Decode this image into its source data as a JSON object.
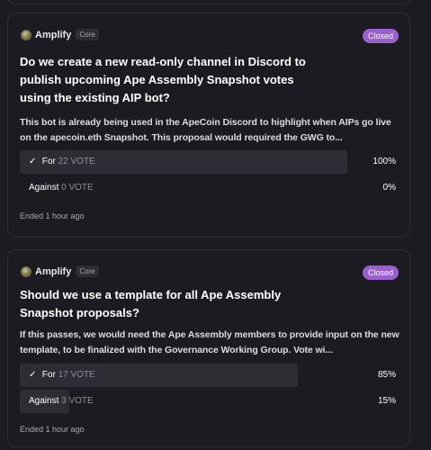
{
  "proposals": [
    {
      "space": "Amplify",
      "tag": "Core",
      "state": "Closed",
      "title": "Do we create a new read-only channel in Discord to publish upcoming Ape Assembly Snapshot votes using the existing AIP bot?",
      "body": "This bot is already being used in the ApeCoin Discord to highlight when AIPs go live on the apecoin.eth Snapshot. This proposal would required the GWG to...",
      "choices": [
        {
          "label": "For",
          "votes": "22 VOTE",
          "percent": "100%",
          "share": 1.0,
          "winner": true
        },
        {
          "label": "Against",
          "votes": "0 VOTE",
          "percent": "0%",
          "share": 0.0,
          "winner": false
        }
      ],
      "ended": "Ended 1 hour ago"
    },
    {
      "space": "Amplify",
      "tag": "Core",
      "state": "Closed",
      "title": "Should we use a template for all Ape Assembly Snapshot proposals?",
      "body": "If this passes, we would need the Ape Assembly members to provide input on the new template, to be finalized with the Governance Working Group. Vote wi...",
      "choices": [
        {
          "label": "For",
          "votes": "17 VOTE",
          "percent": "85%",
          "share": 0.85,
          "winner": true
        },
        {
          "label": "Against",
          "votes": "3 VOTE",
          "percent": "15%",
          "share": 0.15,
          "winner": false
        }
      ],
      "ended": "Ended 1 hour ago"
    }
  ],
  "colors": {
    "background": "#1c1b22",
    "border": "#2e2d36",
    "closed_badge": "#9b5fd0",
    "result_fill": "#2e2d36",
    "muted_text": "#8f8e99"
  },
  "icons": [
    "check-icon",
    "space-avatar-icon"
  ]
}
